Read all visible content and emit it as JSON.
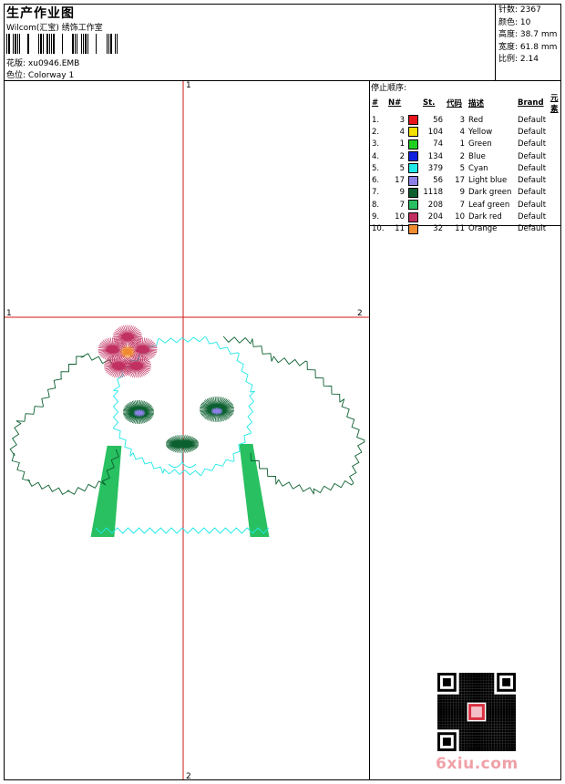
{
  "header": {
    "title": "生产作业图",
    "company": "Wilcom(汇宝) 绣饰工作室",
    "design_label": "花版:",
    "design_value": "xu0946.EMB",
    "colorway_label": "色位:",
    "colorway_value": "Colorway 1"
  },
  "stats": [
    {
      "label": "针数:",
      "value": "2367"
    },
    {
      "label": "颜色:",
      "value": "10"
    },
    {
      "label": "高度:",
      "value": "38.7 mm"
    },
    {
      "label": "宽度:",
      "value": "61.8 mm"
    },
    {
      "label": "比例:",
      "value": "2.14"
    }
  ],
  "stop_sequence": {
    "title": "停止顺序:",
    "columns": [
      "#",
      "N#",
      "St.",
      "代码",
      "描述",
      "Brand",
      "元素"
    ],
    "rows": [
      {
        "idx": "1.",
        "n": "3",
        "color": "#e8141c",
        "st": "56",
        "code": "3",
        "desc": "Red",
        "brand": "Default"
      },
      {
        "idx": "2.",
        "n": "4",
        "color": "#f2e000",
        "st": "104",
        "code": "4",
        "desc": "Yellow",
        "brand": "Default"
      },
      {
        "idx": "3.",
        "n": "1",
        "color": "#20d020",
        "st": "74",
        "code": "1",
        "desc": "Green",
        "brand": "Default"
      },
      {
        "idx": "4.",
        "n": "2",
        "color": "#1020e0",
        "st": "134",
        "code": "2",
        "desc": "Blue",
        "brand": "Default"
      },
      {
        "idx": "5.",
        "n": "5",
        "color": "#20e8e8",
        "st": "379",
        "code": "5",
        "desc": "Cyan",
        "brand": "Default"
      },
      {
        "idx": "6.",
        "n": "17",
        "color": "#8c80e8",
        "st": "56",
        "code": "17",
        "desc": "Light blue",
        "brand": "Default"
      },
      {
        "idx": "7.",
        "n": "9",
        "color": "#0c6030",
        "st": "1118",
        "code": "9",
        "desc": "Dark green",
        "brand": "Default"
      },
      {
        "idx": "8.",
        "n": "7",
        "color": "#28c060",
        "st": "208",
        "code": "7",
        "desc": "Leaf green",
        "brand": "Default"
      },
      {
        "idx": "9.",
        "n": "10",
        "color": "#c03060",
        "st": "204",
        "code": "10",
        "desc": "Dark red",
        "brand": "Default"
      },
      {
        "idx": "10.",
        "n": "11",
        "color": "#f08c30",
        "st": "32",
        "code": "11",
        "desc": "Orange",
        "brand": "Default"
      }
    ]
  },
  "guides": {
    "v_top": "1",
    "v_bottom": "2",
    "h_left": "1",
    "h_right": "2"
  },
  "watermark": {
    "text": "6xiu.com"
  }
}
